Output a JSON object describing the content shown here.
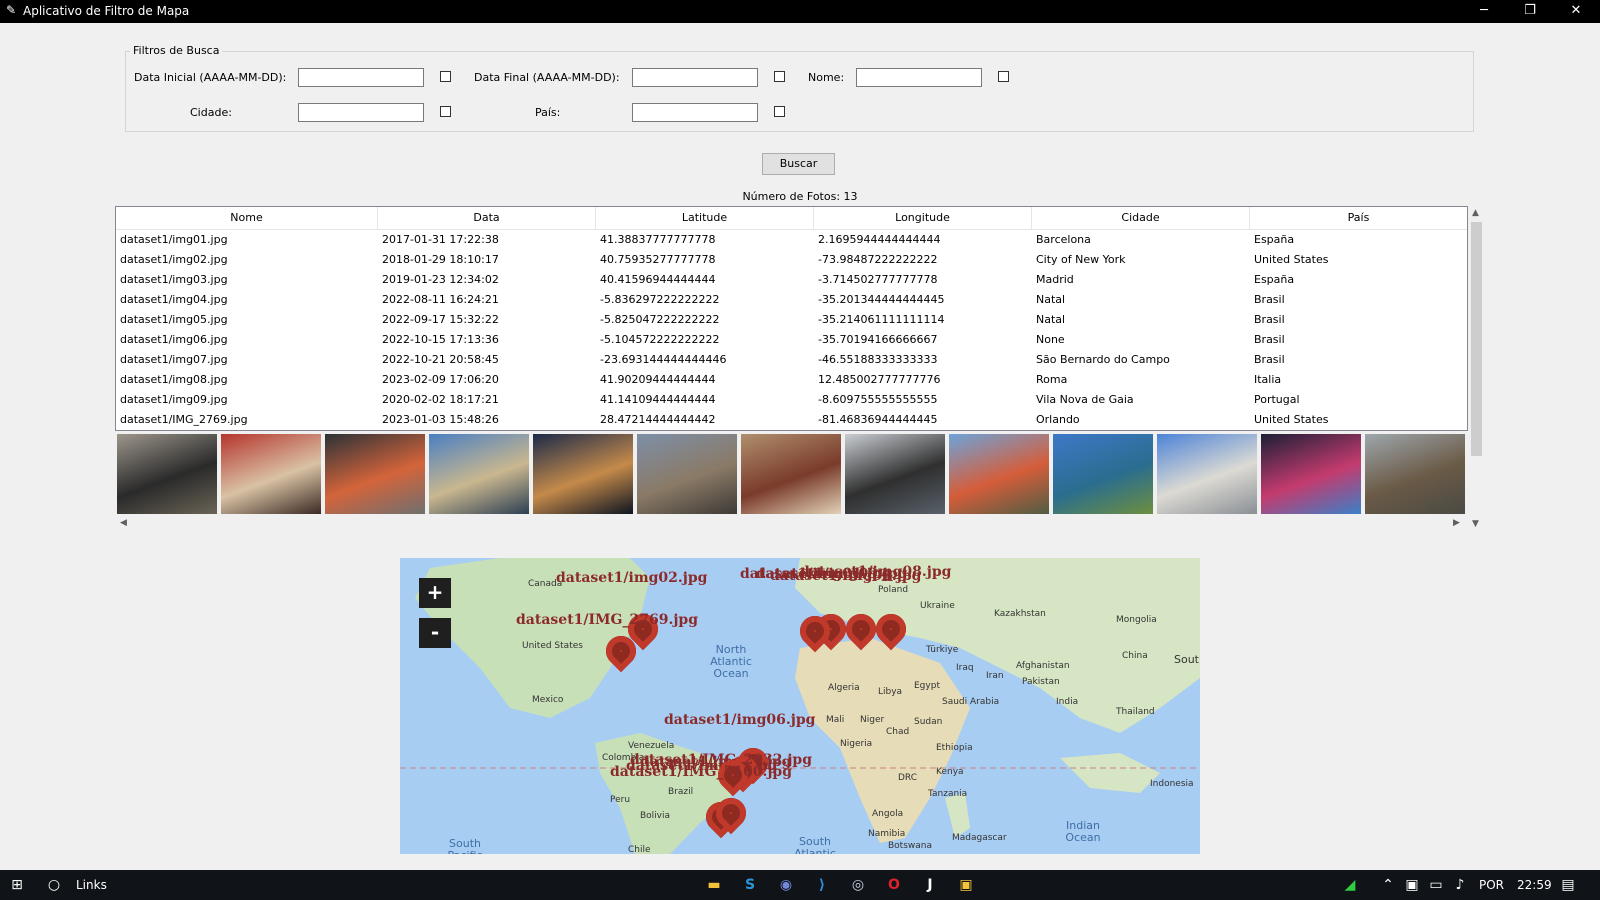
{
  "window": {
    "title": "Aplicativo de Filtro de Mapa",
    "minimize": "─",
    "maximize": "❐",
    "close": "✕"
  },
  "filters": {
    "group_title": "Filtros de Busca",
    "start_date_label": "Data Inicial (AAAA-MM-DD):",
    "end_date_label": "Data Final (AAAA-MM-DD):",
    "name_label": "Nome:",
    "city_label": "Cidade:",
    "country_label": "País:",
    "start_date_value": "",
    "end_date_value": "",
    "name_value": "",
    "city_value": "",
    "country_value": ""
  },
  "search_button": "Buscar",
  "photo_count": "Número de Fotos: 13",
  "table": {
    "headers": [
      "Nome",
      "Data",
      "Latitude",
      "Longitude",
      "Cidade",
      "País"
    ],
    "rows": [
      [
        "dataset1/img01.jpg",
        "2017-01-31 17:22:38",
        "41.38837777777778",
        "2.1695944444444444",
        "Barcelona",
        "España"
      ],
      [
        "dataset1/img02.jpg",
        "2018-01-29 18:10:17",
        "40.75935277777778",
        "-73.98487222222222",
        "City of New York",
        "United States"
      ],
      [
        "dataset1/img03.jpg",
        "2019-01-23 12:34:02",
        "40.41596944444444",
        "-3.714502777777778",
        "Madrid",
        "España"
      ],
      [
        "dataset1/img04.jpg",
        "2022-08-11 16:24:21",
        "-5.836297222222222",
        "-35.201344444444445",
        "Natal",
        "Brasil"
      ],
      [
        "dataset1/img05.jpg",
        "2022-09-17 15:32:22",
        "-5.825047222222222",
        "-35.214061111111114",
        "Natal",
        "Brasil"
      ],
      [
        "dataset1/img06.jpg",
        "2022-10-15 17:13:36",
        "-5.104572222222222",
        "-35.70194166666667",
        "None",
        "Brasil"
      ],
      [
        "dataset1/img07.jpg",
        "2022-10-21 20:58:45",
        "-23.693144444444446",
        "-46.55188333333333",
        "São Bernardo do Campo",
        "Brasil"
      ],
      [
        "dataset1/img08.jpg",
        "2023-02-09 17:06:20",
        "41.90209444444444",
        "12.485002777777776",
        "Roma",
        "Italia"
      ],
      [
        "dataset1/img09.jpg",
        "2020-02-02 18:17:21",
        "41.14109444444444",
        "-8.609755555555555",
        "Vila Nova de Gaia",
        "Portugal"
      ],
      [
        "dataset1/IMG_2769.jpg",
        "2023-01-03 15:48:26",
        "28.47214444444442",
        "-81.46836944444445",
        "Orlando",
        "United States"
      ]
    ]
  },
  "thumbnails": [
    {
      "colors": [
        "#9d968c",
        "#2a2a2a",
        "#6a6456"
      ]
    },
    {
      "colors": [
        "#b5352e",
        "#d9c2a4",
        "#3b2a24"
      ]
    },
    {
      "colors": [
        "#2b3138",
        "#d4643a",
        "#6f6f6f"
      ]
    },
    {
      "colors": [
        "#4a7fc2",
        "#c9b78f",
        "#2d3f53"
      ]
    },
    {
      "colors": [
        "#1b2a4a",
        "#c58a4a",
        "#0e1522"
      ]
    },
    {
      "colors": [
        "#7d8fa8",
        "#8a7a66",
        "#3e3a36"
      ]
    },
    {
      "colors": [
        "#b08f6d",
        "#7a3b2b",
        "#e2d2b8"
      ]
    },
    {
      "colors": [
        "#c9cdd2",
        "#2f2f2f",
        "#58616a"
      ]
    },
    {
      "colors": [
        "#6da4da",
        "#d55d3a",
        "#4f5d43"
      ]
    },
    {
      "colors": [
        "#3d78c8",
        "#2a6d8f",
        "#6d8f3f"
      ]
    },
    {
      "colors": [
        "#4c83d8",
        "#dcdad3",
        "#8a8f96"
      ]
    },
    {
      "colors": [
        "#1c1f36",
        "#c43b6e",
        "#3a80c8"
      ]
    },
    {
      "colors": [
        "#9ea6ac",
        "#6a5a46",
        "#4a4a44"
      ]
    }
  ],
  "map": {
    "zoom_in": "+",
    "zoom_out": "-",
    "place_labels": [
      "Canada",
      "United States",
      "Mexico",
      "North Atlantic Ocean",
      "Venezuela",
      "Colombia",
      "Peru",
      "Brazil",
      "Bolivia",
      "Chile",
      "South Pacific",
      "South Atlantic",
      "Poland",
      "Ukraine",
      "Kazakhstan",
      "Mongolia",
      "Türkiye",
      "Iraq",
      "Iran",
      "Afghanistan",
      "Pakistan",
      "China",
      "South",
      "India",
      "Thailand",
      "Indonesia",
      "Algeria",
      "Libya",
      "Egypt",
      "Saudi Arabia",
      "Mali",
      "Niger",
      "Chad",
      "Sudan",
      "Nigeria",
      "Ethiopia",
      "DRC",
      "Kenya",
      "Tanzania",
      "Angola",
      "Namibia",
      "Botswana",
      "Madagascar",
      "Indian Ocean"
    ],
    "marker_labels": [
      "dataset1/img02.jpg",
      "dataset1/IMG_2769.jpg",
      "dataset1/img01.jpg",
      "dataset1/img03.jpg",
      "dataset1/img08.jpg",
      "dataset1/img09.jpg",
      "dataset1/img06.jpg",
      "dataset1/img04.jpg",
      "dataset1/img05.jpg",
      "dataset1/IMG_2032.jpg",
      "dataset1/IMG_5160.jpg"
    ],
    "marker_color": "#c0392b"
  },
  "taskbar": {
    "search_text": "Links",
    "language": "POR",
    "time": "22:59",
    "apps": [
      "file-explorer-icon",
      "skype-icon",
      "discord-icon",
      "vscode-icon",
      "steam-icon",
      "opera-icon",
      "intellij-icon",
      "python-icon"
    ]
  }
}
